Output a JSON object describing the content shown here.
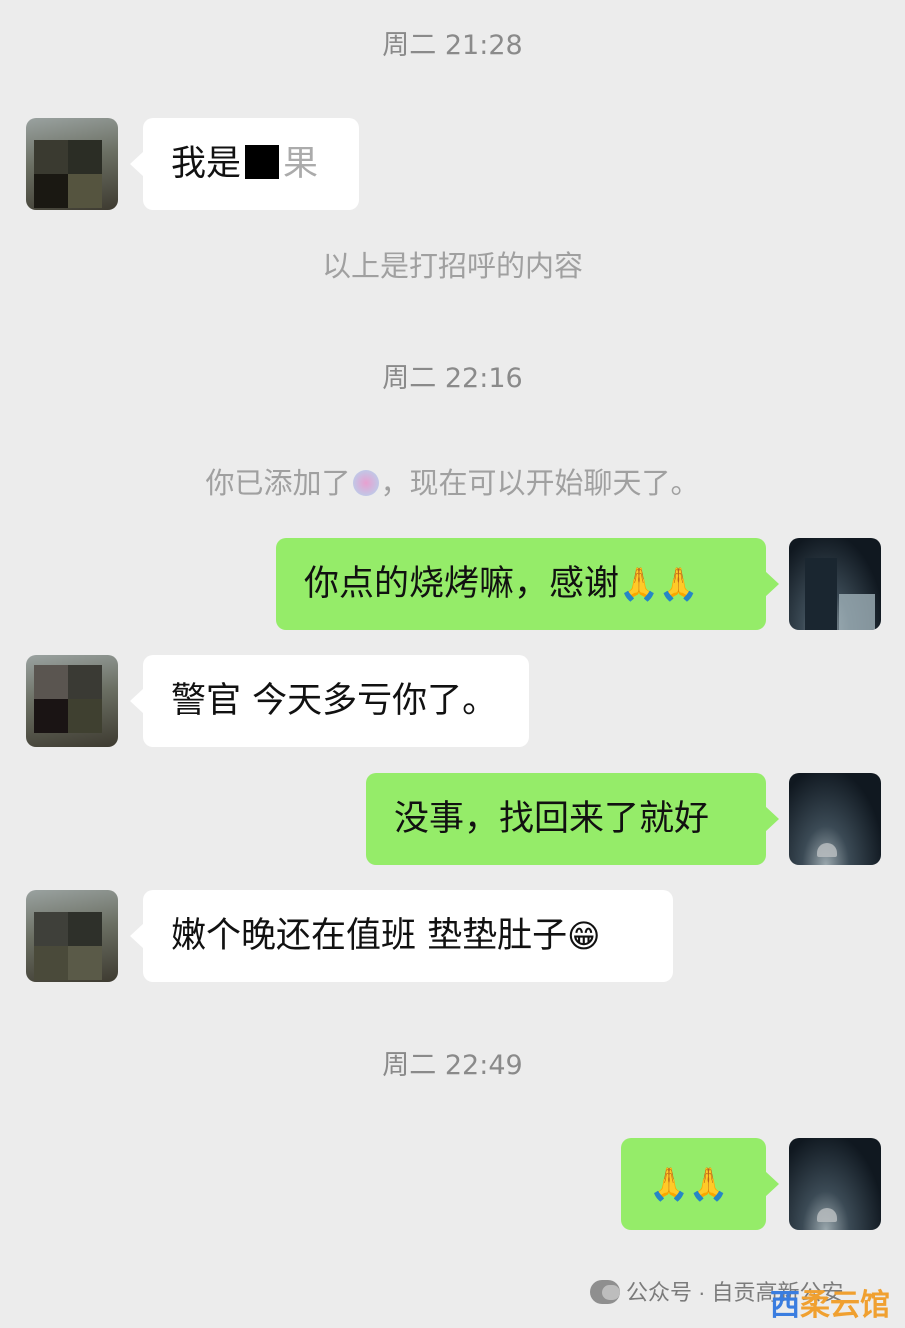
{
  "timestamps": [
    "周二 21:28",
    "周二 22:16",
    "周二 22:49"
  ],
  "system": {
    "greeting_note": "以上是打招呼的内容",
    "added_prefix": "你已添加了",
    "added_suffix": "，现在可以开始聊天了。"
  },
  "messages": [
    {
      "side": "recv",
      "pre": "我是",
      "post": "果"
    },
    {
      "side": "sent",
      "text": "你点的烧烤嘛，感谢",
      "emoji": "🙏🙏"
    },
    {
      "side": "recv",
      "text": "警官 今天多亏你了。"
    },
    {
      "side": "sent",
      "text": "没事，找回来了就好"
    },
    {
      "side": "recv",
      "text": "嫩个晚还在值班 垫垫肚子",
      "emoji": "😁"
    },
    {
      "side": "sent",
      "text": "",
      "emoji": "🙏🙏"
    }
  ],
  "watermark": {
    "text": "公众号 · 自贡高新公安",
    "icon": "wechat-official-account-icon",
    "brand_a": "西",
    "brand_b": "柔云馆"
  }
}
